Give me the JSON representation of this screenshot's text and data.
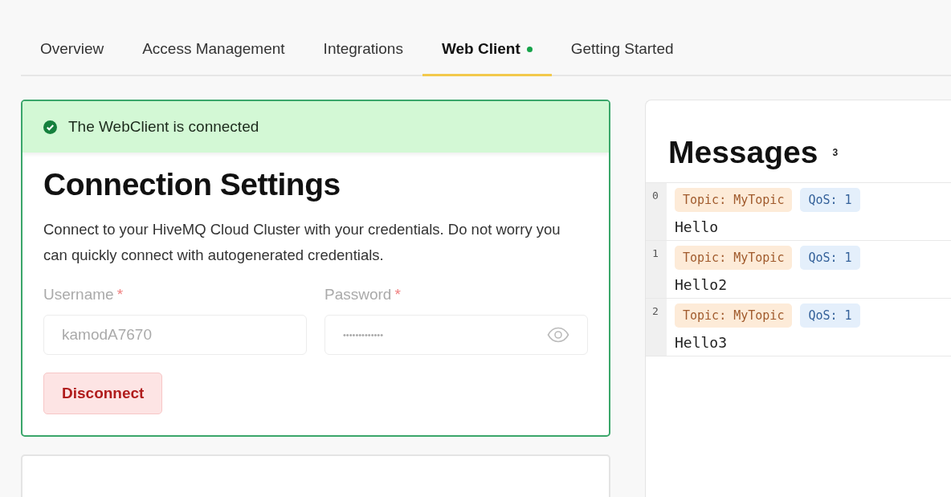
{
  "tabs": [
    {
      "label": "Overview",
      "selected": false,
      "indicator": false
    },
    {
      "label": "Access Management",
      "selected": false,
      "indicator": false
    },
    {
      "label": "Integrations",
      "selected": false,
      "indicator": false
    },
    {
      "label": "Web Client",
      "selected": true,
      "indicator": true
    },
    {
      "label": "Getting Started",
      "selected": false,
      "indicator": false
    }
  ],
  "connection": {
    "connected": true,
    "status": "The WebClient is connected",
    "title": "Connection Settings",
    "description": "Connect to your HiveMQ Cloud Cluster with your credentials. Do not worry you can quickly connect with autogenerated credentials.",
    "fields": [
      {
        "kind": "text",
        "label": "Username",
        "required_mark": "*",
        "value": "kamodA7670",
        "disabled": true
      },
      {
        "kind": "password",
        "label": "Password",
        "required_mark": "*",
        "value": "•••••••••••••",
        "disabled": true
      }
    ],
    "button": "Disconnect"
  },
  "messages": {
    "title": "Messages",
    "count": "3",
    "items": [
      {
        "index": "0",
        "topic": "Topic: MyTopic",
        "qos": "QoS: 1",
        "payload": "Hello"
      },
      {
        "index": "1",
        "topic": "Topic: MyTopic",
        "qos": "QoS: 1",
        "payload": "Hello2"
      },
      {
        "index": "2",
        "topic": "Topic: MyTopic",
        "qos": "QoS: 1",
        "payload": "Hello3"
      }
    ]
  }
}
